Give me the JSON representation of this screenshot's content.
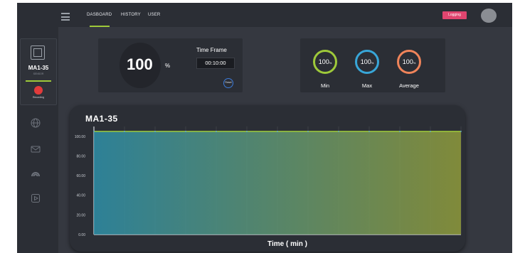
{
  "header": {
    "nav": [
      {
        "label": "DASBOARD",
        "active": true
      },
      {
        "label": "HISTORY",
        "active": false
      },
      {
        "label": "USER",
        "active": false
      }
    ],
    "login_label": "Logging"
  },
  "sidebar": {
    "device": {
      "name": "MA1-35",
      "subtitle": "SENSOR",
      "record_label": "Recording"
    },
    "icons": [
      "globe-icon",
      "mail-icon",
      "signal-icon",
      "play-icon"
    ]
  },
  "stats": {
    "current_value": "100",
    "current_unit": "%",
    "time_frame_label": "Time Frame",
    "time_frame_value": "00:10:00",
    "reset_label": "Reset",
    "rings": [
      {
        "value": "100",
        "unit": "%",
        "label": "Min",
        "color": "#9ec93a"
      },
      {
        "value": "100",
        "unit": "%",
        "label": "Max",
        "color": "#38a6d8"
      },
      {
        "value": "100",
        "unit": "%",
        "label": "Average",
        "color": "#f0845a"
      }
    ]
  },
  "chart_data": {
    "type": "area",
    "title": "MA1-35",
    "xlabel": "Time ( min )",
    "ylabel": "",
    "yticks": [
      "100.00",
      "80.00",
      "60.00",
      "40.00",
      "20.00",
      "0.00"
    ],
    "ylim": [
      0,
      110
    ],
    "grid": true,
    "series": [
      {
        "values": [
          105,
          105,
          105,
          105,
          105,
          105,
          105,
          105,
          105,
          105,
          105,
          105,
          105
        ]
      }
    ],
    "colors": {
      "line": "#9ec93a",
      "fill_left": "#2e8fa8",
      "fill_right": "#8f9a3b"
    }
  }
}
